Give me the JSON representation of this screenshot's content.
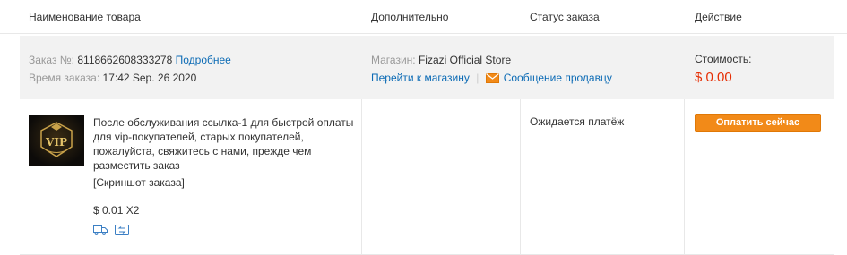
{
  "header": {
    "col_product": "Наименование товара",
    "col_extra": "Дополнительно",
    "col_status": "Статус заказа",
    "col_action": "Действие"
  },
  "order": {
    "number_label": "Заказ №:",
    "number": "8118662608333278",
    "details_link": "Подробнее",
    "time_label": "Время заказа:",
    "time": "17:42 Sep. 26 2020",
    "store_label": "Магазин:",
    "store_name": "Fizazi Official Store",
    "go_to_store_link": "Перейти к магазину",
    "separator": "|",
    "message_seller_link": "Сообщение продавцу",
    "cost_label": "Стоимость:",
    "cost": "$ 0.00"
  },
  "item": {
    "description": "После обслуживания ссылка-1 для быстрой оплаты для vip-покупателей, старых покупателей, пожалуйста, свяжитесь с нами, прежде чем разместить заказ",
    "snapshot_link": "[Скриншот заказа]",
    "price": "$ 0.01 X2",
    "thumbnail_text": "VIP",
    "status": "Ожидается платёж",
    "pay_button": "Оплатить сейчас"
  },
  "colors": {
    "accent_link": "#0c6bb5",
    "price_red": "#e62e04",
    "pay_button_orange": "#f28a18",
    "order_bar_bg": "#f2f2f2"
  },
  "icons": [
    "mail-icon",
    "truck-icon",
    "return-icon"
  ]
}
